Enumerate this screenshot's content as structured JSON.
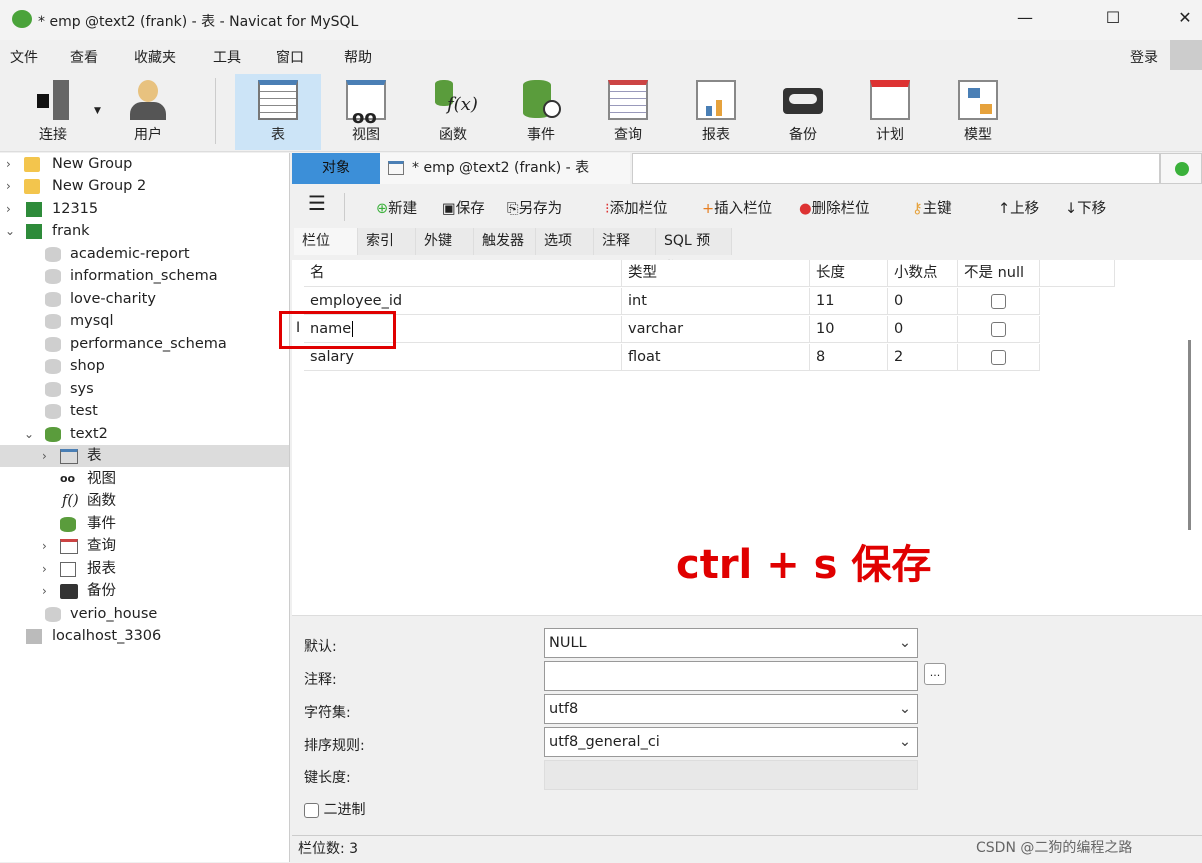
{
  "window": {
    "title": "* emp @text2 (frank) - 表 - Navicat for MySQL",
    "minimize": "—",
    "maximize": "☐",
    "close": "✕"
  },
  "menu": [
    "文件",
    "查看",
    "收藏夹",
    "工具",
    "窗口",
    "帮助"
  ],
  "login": "登录",
  "toolbar": [
    "连接",
    "用户",
    "表",
    "视图",
    "函数",
    "事件",
    "查询",
    "报表",
    "备份",
    "计划",
    "模型"
  ],
  "sidebar": [
    "New Group",
    "New Group 2",
    "12315",
    "frank",
    "academic-report",
    "information_schema",
    "love-charity",
    "mysql",
    "performance_schema",
    "shop",
    "sys",
    "test",
    "text2",
    "表",
    "视图",
    "函数",
    "事件",
    "查询",
    "报表",
    "备份",
    "verio_house",
    "localhost_3306"
  ],
  "tabs": {
    "objects": "对象",
    "doc": "* emp @text2 (frank) - 表"
  },
  "editor_toolbar": [
    "新建",
    "保存",
    "另存为",
    "添加栏位",
    "插入栏位",
    "删除栏位",
    "主键",
    "上移",
    "下移"
  ],
  "subtabs": [
    "栏位",
    "索引",
    "外键",
    "触发器",
    "选项",
    "注释",
    "SQL 预览"
  ],
  "grid": {
    "headers": [
      "名",
      "类型",
      "长度",
      "小数点",
      "不是 null"
    ],
    "rows": [
      [
        "employee_id",
        "int",
        "11",
        "0",
        false
      ],
      [
        "name",
        "varchar",
        "10",
        "0",
        false
      ],
      [
        "salary",
        "float",
        "8",
        "2",
        false
      ]
    ]
  },
  "annotation": "ctrl + s 保存",
  "props": {
    "default_label": "默认:",
    "default_value": "NULL",
    "comment_label": "注释:",
    "comment_value": "",
    "ellipsis": "...",
    "charset_label": "字符集:",
    "charset_value": "utf8",
    "collation_label": "排序规则:",
    "collation_value": "utf8_general_ci",
    "keylen_label": "键长度:",
    "binary_label": "二进制"
  },
  "status": "栏位数: 3",
  "watermark": "CSDN @二狗的编程之路",
  "colors": {
    "accent": "#3c8fd8",
    "annotation": "#e00000",
    "selected_tool": "#cce4f7"
  }
}
